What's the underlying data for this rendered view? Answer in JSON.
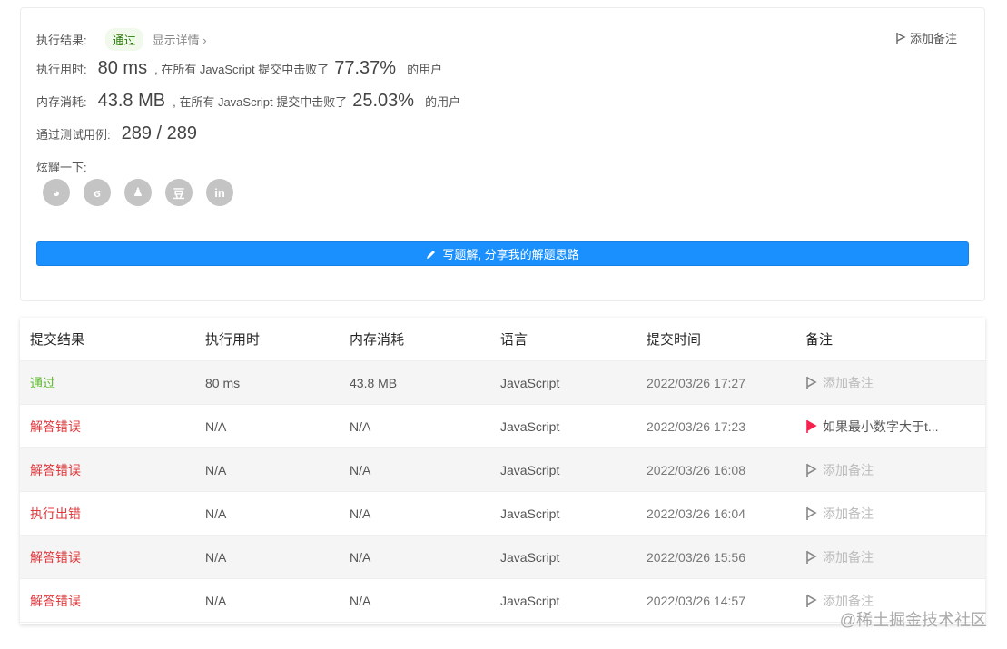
{
  "result": {
    "label": "执行结果:",
    "status": "通过",
    "detail_link": "显示详情 ›",
    "add_note": "添加备注"
  },
  "runtime": {
    "label": "执行用时:",
    "value": "80 ms",
    "text": ", 在所有 JavaScript 提交中击败了",
    "percent": "77.37%",
    "suffix": "的用户"
  },
  "memory": {
    "label": "内存消耗:",
    "value": "43.8 MB",
    "text": ", 在所有 JavaScript 提交中击败了",
    "percent": "25.03%",
    "suffix": "的用户"
  },
  "tests": {
    "label": "通过测试用例:",
    "value": "289 / 289"
  },
  "share": {
    "label": "炫耀一下:",
    "icons": [
      "wechat-icon",
      "weibo-icon",
      "qq-icon",
      "douban-icon",
      "linkedin-icon"
    ],
    "glyphs": [
      "◕",
      "ϭ",
      "♟",
      "豆",
      "in"
    ]
  },
  "write_button": "写题解, 分享我的解题思路",
  "table": {
    "headers": [
      "提交结果",
      "执行用时",
      "内存消耗",
      "语言",
      "提交时间",
      "备注"
    ],
    "rows": [
      {
        "status": "通过",
        "kind": "green",
        "runtime": "80 ms",
        "memory": "43.8 MB",
        "lang": "JavaScript",
        "time": "2022/03/26 17:27",
        "note": "添加备注",
        "flag": false
      },
      {
        "status": "解答错误",
        "kind": "red",
        "runtime": "N/A",
        "memory": "N/A",
        "lang": "JavaScript",
        "time": "2022/03/26 17:23",
        "note": "如果最小数字大于t...",
        "flag": true
      },
      {
        "status": "解答错误",
        "kind": "red",
        "runtime": "N/A",
        "memory": "N/A",
        "lang": "JavaScript",
        "time": "2022/03/26 16:08",
        "note": "添加备注",
        "flag": false
      },
      {
        "status": "执行出错",
        "kind": "red",
        "runtime": "N/A",
        "memory": "N/A",
        "lang": "JavaScript",
        "time": "2022/03/26 16:04",
        "note": "添加备注",
        "flag": false
      },
      {
        "status": "解答错误",
        "kind": "red",
        "runtime": "N/A",
        "memory": "N/A",
        "lang": "JavaScript",
        "time": "2022/03/26 15:56",
        "note": "添加备注",
        "flag": false
      },
      {
        "status": "解答错误",
        "kind": "red",
        "runtime": "N/A",
        "memory": "N/A",
        "lang": "JavaScript",
        "time": "2022/03/26 14:57",
        "note": "添加备注",
        "flag": false
      }
    ]
  },
  "watermark": "@稀土掘金技术社区",
  "colors": {
    "accent": "#1a90ff",
    "error": "#e0393e",
    "success": "#5cb82c",
    "flag_active": "#f5224d"
  }
}
